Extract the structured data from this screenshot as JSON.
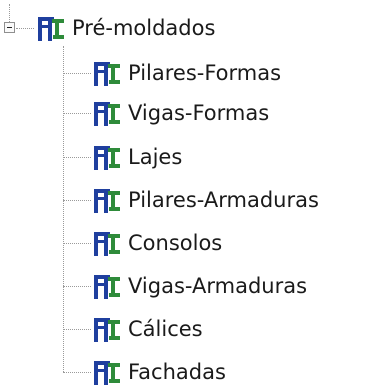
{
  "tree": {
    "root": {
      "label": "Pré-moldados",
      "expanded": true,
      "icon": "precast-structure-icon"
    },
    "children": [
      {
        "label": "Pilares-Formas",
        "icon": "precast-structure-icon"
      },
      {
        "label": "Vigas-Formas",
        "icon": "precast-structure-icon"
      },
      {
        "label": "Lajes",
        "icon": "precast-structure-icon"
      },
      {
        "label": "Pilares-Armaduras",
        "icon": "precast-structure-icon"
      },
      {
        "label": "Consolos",
        "icon": "precast-structure-icon"
      },
      {
        "label": "Vigas-Armaduras",
        "icon": "precast-structure-icon"
      },
      {
        "label": "Cálices",
        "icon": "precast-structure-icon"
      },
      {
        "label": "Fachadas",
        "icon": "precast-structure-icon"
      }
    ]
  },
  "colors": {
    "icon_blue": "#1f3f9e",
    "icon_green": "#2e8b3a",
    "connector": "#9a9a9a"
  }
}
